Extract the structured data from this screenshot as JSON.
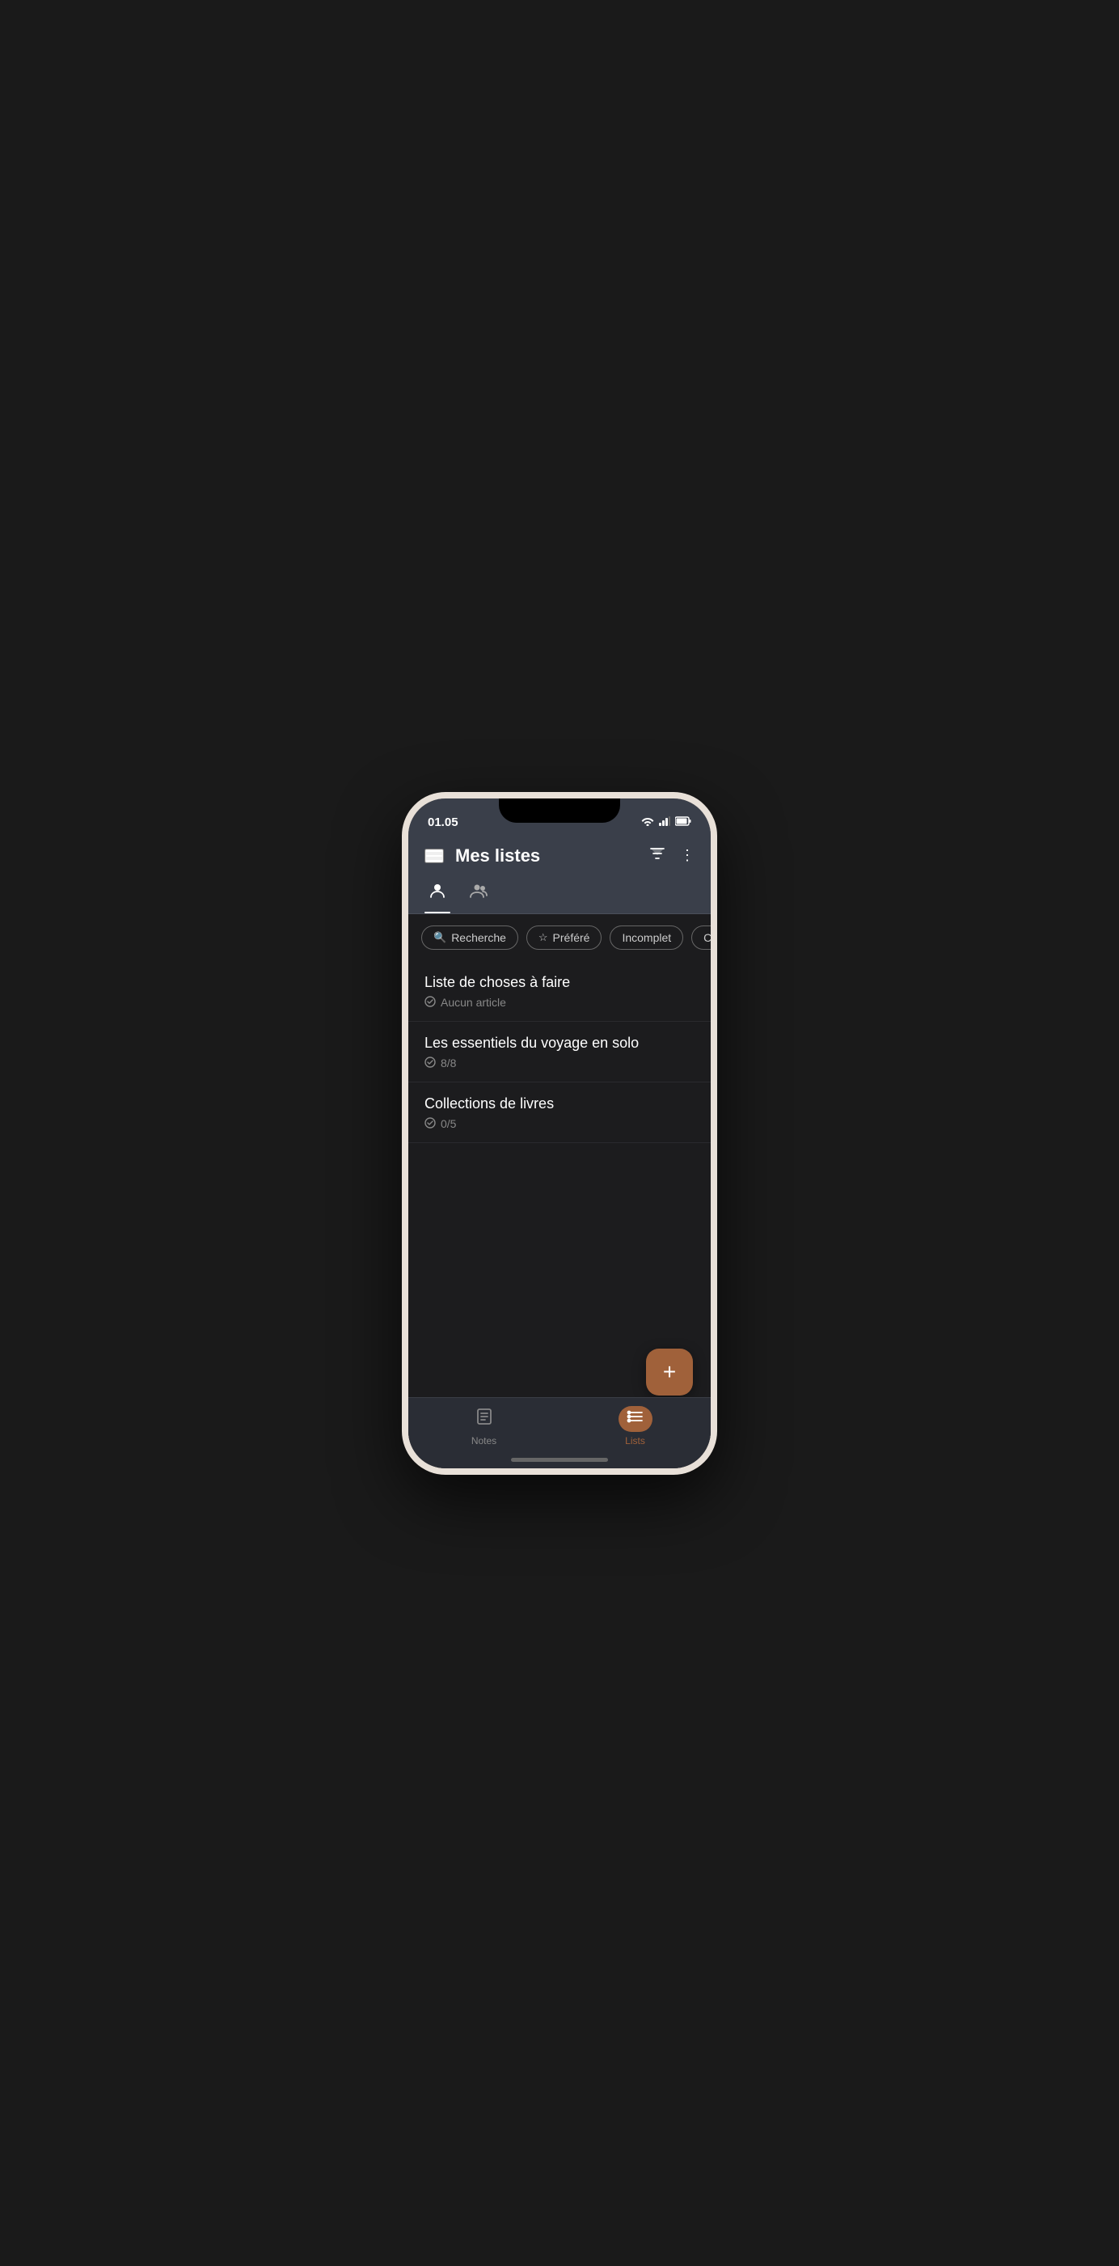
{
  "status": {
    "time": "01.05",
    "wifi": "📶",
    "signal": "▲",
    "battery": "🔋"
  },
  "header": {
    "title": "Mes listes",
    "menu_icon": "☰",
    "filter_icon": "⛾",
    "more_icon": "⋮"
  },
  "tabs": [
    {
      "label": "👤",
      "active": true
    },
    {
      "label": "👥",
      "active": false
    }
  ],
  "filters": [
    {
      "label": "Recherche",
      "icon": "🔍",
      "type": "search"
    },
    {
      "label": "Préféré",
      "icon": "☆",
      "type": "favorite"
    },
    {
      "label": "Incomplet",
      "icon": "",
      "type": "incomplete"
    },
    {
      "label": "Complété",
      "icon": "",
      "type": "complete"
    }
  ],
  "lists": [
    {
      "title": "Liste de choses à faire",
      "subtitle": "Aucun article",
      "count": ""
    },
    {
      "title": "Les essentiels du voyage en solo",
      "subtitle": "8/8",
      "count": "8/8"
    },
    {
      "title": "Collections de livres",
      "subtitle": "0/5",
      "count": "0/5"
    }
  ],
  "fab": {
    "label": "+"
  },
  "bottom_nav": [
    {
      "label": "Notes",
      "active": false
    },
    {
      "label": "Lists",
      "active": true
    }
  ]
}
